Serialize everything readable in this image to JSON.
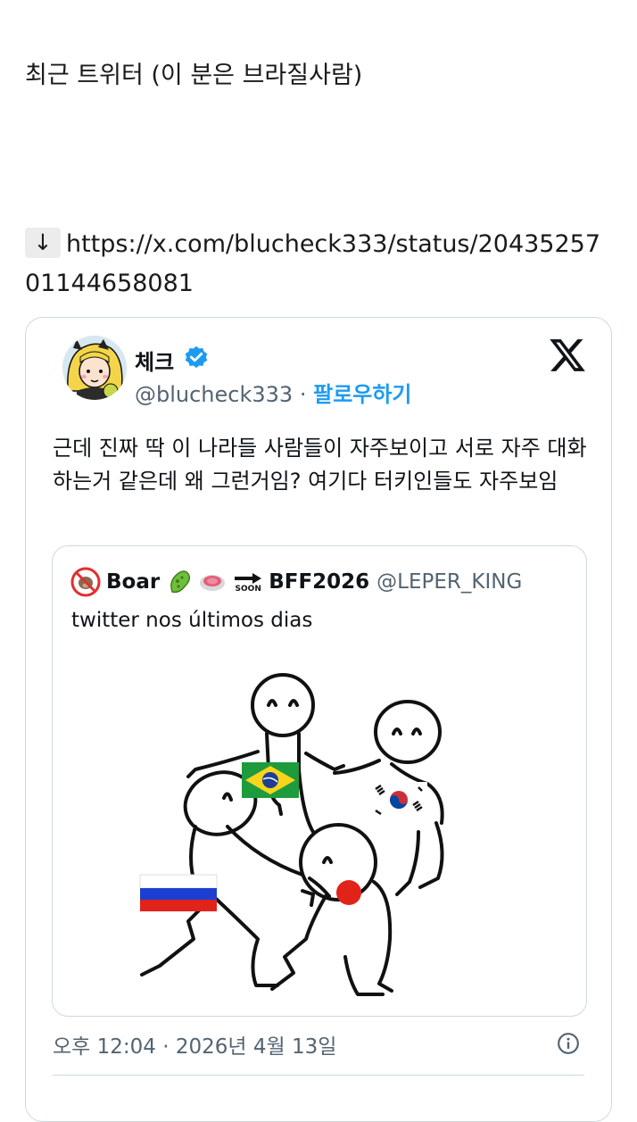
{
  "post": {
    "title": "최근 트위터 (이 분은 브라질사람)",
    "link_arrow": "↓",
    "link_url": "https://x.com/blucheck333/status/2043525701144658081"
  },
  "tweet": {
    "display_name": "체크",
    "handle": "@blucheck333",
    "separator": "·",
    "follow_label": "팔로우하기",
    "text": "근데 진짜 딱 이 나라들 사람들이 자주보이고 서로 자주 대화하는거 같은데 왜 그런거임? 여기다 터키인들도 자주보임",
    "timestamp": "오후 12:04 · 2026년 4월 13일",
    "colors": {
      "accent": "#1d9bf0",
      "secondary_text": "#536471",
      "border": "#cfd9de"
    },
    "icons": [
      "verified-badge-icon",
      "x-logo-icon",
      "info-icon"
    ]
  },
  "quote": {
    "name_part1": "Boar",
    "soon_label": "SOON",
    "name_part2": "BFF2026",
    "handle": "@LEPER_KING",
    "text": "twitter nos últimos dias",
    "emoji_icons": [
      "no-pig-icon",
      "microbe-icon",
      "meat-icon",
      "soon-arrow-icon"
    ],
    "flag_icons": [
      "brazil-flag-icon",
      "south-korea-flag-icon",
      "russia-flag-icon",
      "japan-flag-icon"
    ]
  }
}
